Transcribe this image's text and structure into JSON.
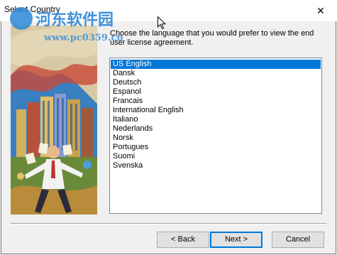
{
  "window": {
    "title": "Select Country",
    "close_glyph": "✕"
  },
  "instruction": "Choose the language that you would prefer to view the end user license agreement.",
  "languages": {
    "items": [
      "US English",
      "Dansk",
      "Deutsch",
      "Espanol",
      "Francais",
      "International English",
      "Italiano",
      "Nederlands",
      "Norsk",
      "Portugues",
      "Suomi",
      "Svenska"
    ],
    "selected": "US English"
  },
  "buttons": {
    "back": "< Back",
    "next": "Next >",
    "cancel": "Cancel"
  },
  "watermark": {
    "title": "河东软件园",
    "url": "www.pc0359.cn"
  },
  "colors": {
    "selection": "#0078d7",
    "watermark": "#2d86d6"
  }
}
